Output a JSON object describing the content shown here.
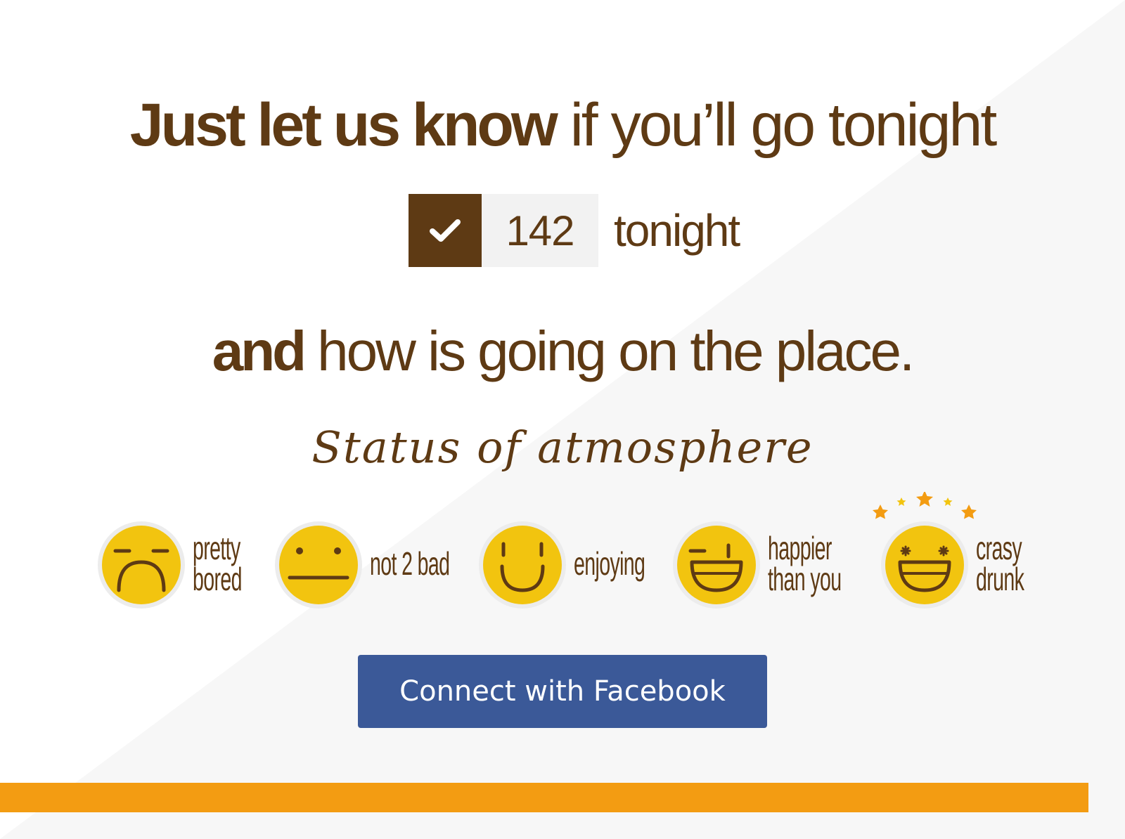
{
  "headline": {
    "bold": "Just let us know",
    "light": " if you’ll go tonight"
  },
  "counter": {
    "count": "142",
    "label": "tonight",
    "icon": "check-icon"
  },
  "subheadline": {
    "bold": "and",
    "light": " how is going on the place."
  },
  "status": {
    "title": "Status of atmosphere",
    "moods": [
      {
        "line1": "pretty",
        "line2": "bored",
        "icon": "sad-face-icon"
      },
      {
        "line1": "not 2 bad",
        "line2": "",
        "icon": "neutral-face-icon"
      },
      {
        "line1": "enjoying",
        "line2": "",
        "icon": "smile-face-icon"
      },
      {
        "line1": "happier",
        "line2": "than you",
        "icon": "laughing-face-icon"
      },
      {
        "line1": "crasy",
        "line2": "drunk",
        "icon": "drunk-face-icon"
      }
    ]
  },
  "cta": {
    "facebook_label": "Connect with Facebook"
  },
  "colors": {
    "brown": "#5e3a14",
    "yellow": "#f2c40f",
    "orange": "#f39c12",
    "facebook": "#3b5998"
  }
}
